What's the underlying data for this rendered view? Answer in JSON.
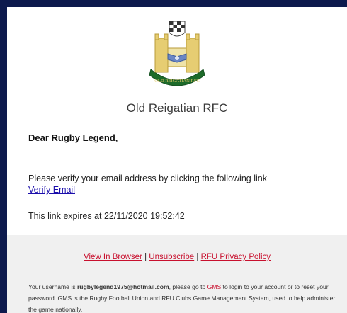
{
  "header": {
    "club_name": "Old Reigatian RFC",
    "logo_text": "OLD REIGATIAN RFC"
  },
  "email": {
    "greeting": "Dear Rugby Legend,",
    "verify_instruction": "Please verify your email address by clicking the following link",
    "verify_link": "Verify Email",
    "expiry_text": "This link expires at 22/11/2020 19:52:42"
  },
  "footer": {
    "view_in_browser": "View In Browser",
    "unsubscribe": "Unsubscribe",
    "privacy_policy": "RFU Privacy Policy",
    "separator": " | ",
    "note_prefix": "Your username is ",
    "username": "rugbylegend1975@hotmail.com",
    "note_middle": ", please go to ",
    "gms_link": "GMS",
    "note_suffix": " to login to your account or to reset your password. GMS is the Rugby Football Union and RFU Clubs Game Management System, used to help administer the game nationally."
  },
  "colors": {
    "page_background": "#0d1a4d",
    "link_blue": "#1a0dab",
    "footer_link_red": "#c8102e",
    "footer_background": "#f0f0f0",
    "logo_green": "#1d6b2a",
    "logo_gold": "#e0c766"
  }
}
